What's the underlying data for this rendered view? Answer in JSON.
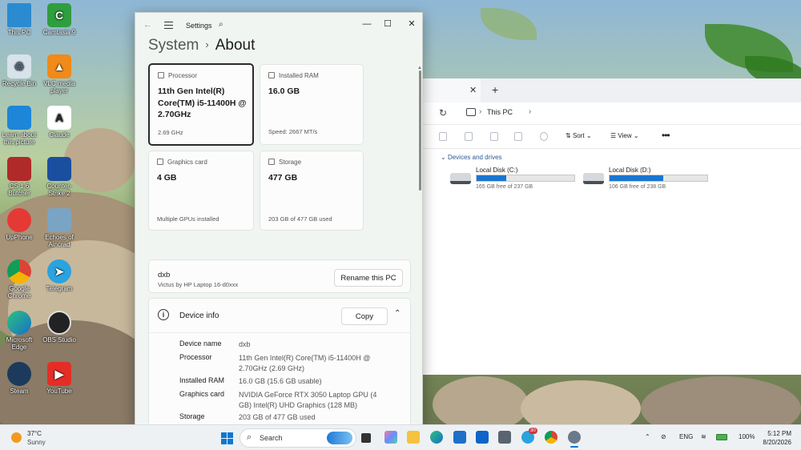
{
  "desktop": {
    "icons": [
      {
        "label": "This PC"
      },
      {
        "label": "Camtasia 9"
      },
      {
        "label": "Recycle Bin"
      },
      {
        "label": "VLC media player"
      },
      {
        "label": "Learn about this picture"
      },
      {
        "label": "Claude"
      },
      {
        "label": "CS 1.6 Butcher"
      },
      {
        "label": "Counter-Strike 2"
      },
      {
        "label": "UpPhone"
      },
      {
        "label": "Echoes of Aincrad"
      },
      {
        "label": "Google Chrome"
      },
      {
        "label": "Telegram"
      },
      {
        "label": "Microsoft Edge"
      },
      {
        "label": "OBS Studio"
      },
      {
        "label": "Steam"
      },
      {
        "label": "YouTube"
      }
    ]
  },
  "explorer": {
    "breadcrumb": "This PC",
    "toolbar": {
      "sort": "Sort",
      "view": "View",
      "more": "•••"
    },
    "section": "Devices and drives",
    "drives": [
      {
        "name": "Local Disk (C:)",
        "free": "165 GB free of 237 GB",
        "used_fraction": 0.3
      },
      {
        "name": "Local Disk (D:)",
        "free": "106 GB free of 238 GB",
        "used_fraction": 0.55
      }
    ]
  },
  "settings": {
    "app_title": "Settings",
    "header": {
      "parent": "System",
      "current": "About"
    },
    "cards": {
      "processor": {
        "label": "Processor",
        "value": "11th Gen Intel(R) Core(TM) i5-11400H @ 2.70GHz",
        "sub": "2.69 GHz"
      },
      "ram": {
        "label": "Installed RAM",
        "value": "16.0 GB",
        "sub": "Speed: 2667 MT/s"
      },
      "gpu": {
        "label": "Graphics card",
        "value": "4 GB",
        "sub": "Multiple GPUs installed"
      },
      "storage": {
        "label": "Storage",
        "value": "477 GB",
        "sub": "203 GB of 477 GB used"
      }
    },
    "pc": {
      "name": "dxb",
      "model": "Victus by HP Laptop 16-d0xxx",
      "rename_button": "Rename this PC"
    },
    "device_info": {
      "title": "Device info",
      "copy_button": "Copy",
      "specs": [
        {
          "key": "Device name",
          "value": "dxb"
        },
        {
          "key": "Processor",
          "value": "11th Gen Intel(R) Core(TM) i5-11400H @ 2.70GHz (2.69 GHz)"
        },
        {
          "key": "Installed RAM",
          "value": "16.0 GB (15.6 GB usable)"
        },
        {
          "key": "Graphics card",
          "value": "NVIDIA GeForce RTX 3050 Laptop GPU (4 GB) Intel(R) UHD Graphics (128 MB)"
        },
        {
          "key": "Storage",
          "value": "203 GB of 477 GB used"
        }
      ]
    }
  },
  "taskbar": {
    "weather": {
      "temp": "37°C",
      "condition": "Sunny"
    },
    "search_placeholder": "Search",
    "telegram_badge": "30",
    "language": "ENG",
    "battery": "100%",
    "time": "5:12 PM",
    "date": "8/20/2026"
  },
  "colors": {
    "accent": "#0a78d4",
    "drive_fill": "#1976d2"
  }
}
